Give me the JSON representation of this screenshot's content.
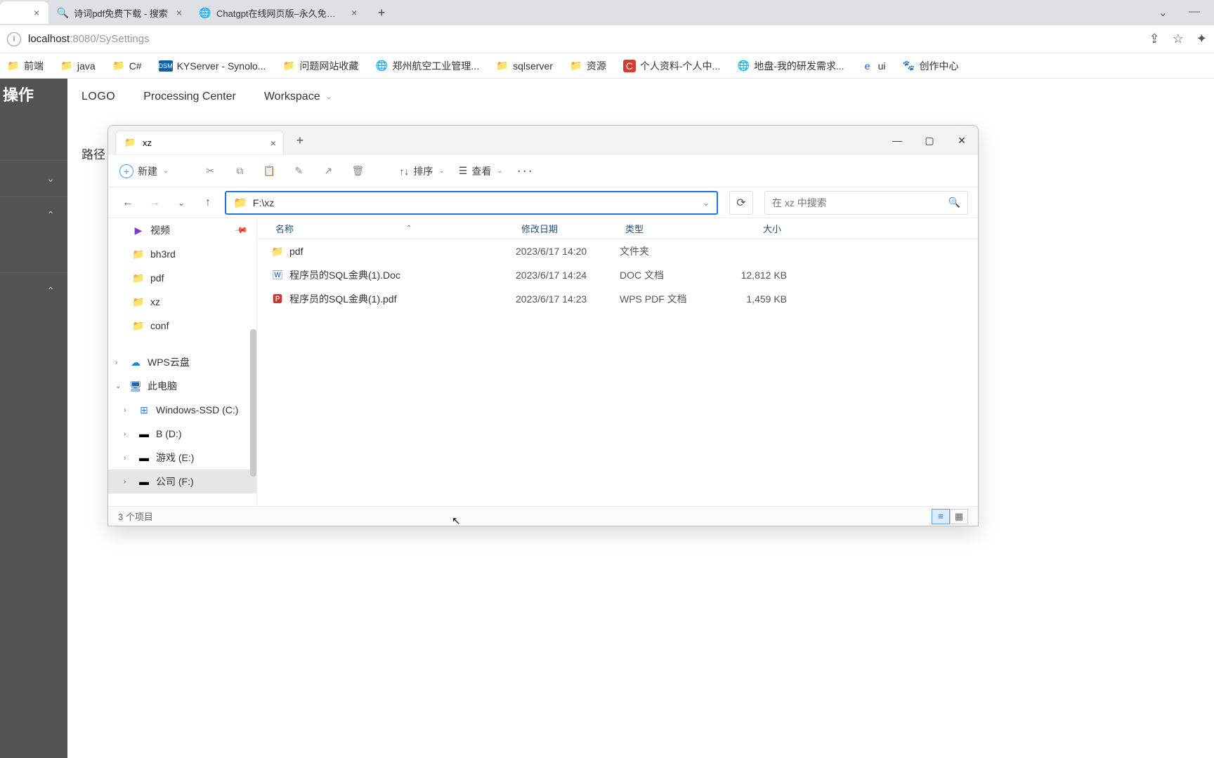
{
  "browser": {
    "tabs": [
      {
        "title": "",
        "active": true
      },
      {
        "title": "诗词pdf免费下载 - 搜索",
        "active": false
      },
      {
        "title": "Chatgpt在线网页版–永久免费使",
        "active": false
      }
    ],
    "url_host": "localhost",
    "url_port": ":8080",
    "url_path": "/SySettings",
    "window_hint_dd": "⌄",
    "window_hint_min": "—"
  },
  "bookmarks": [
    {
      "label": "前端",
      "icon": "folder"
    },
    {
      "label": "java",
      "icon": "folder"
    },
    {
      "label": "C#",
      "icon": "folder"
    },
    {
      "label": "KYServer - Synolo...",
      "icon": "dsm"
    },
    {
      "label": "问题网站收藏",
      "icon": "folder"
    },
    {
      "label": "郑州航空工业管理...",
      "icon": "globe"
    },
    {
      "label": "sqlserver",
      "icon": "folder"
    },
    {
      "label": "资源",
      "icon": "folder"
    },
    {
      "label": "个人资料-个人中...",
      "icon": "c-red"
    },
    {
      "label": "地盘-我的研发需求...",
      "icon": "globe-blue"
    },
    {
      "label": "ui",
      "icon": "ie"
    },
    {
      "label": "创作中心",
      "icon": "paw"
    }
  ],
  "left_panel": {
    "title": "操作",
    "chevrons": [
      "⌄",
      "⌃",
      "⌃",
      "⌃"
    ]
  },
  "top_nav": {
    "logo": "LOGO",
    "items": [
      "Processing Center",
      "Workspace"
    ]
  },
  "path_label": "路径",
  "explorer": {
    "tab_title": "xz",
    "toolbar": {
      "new_label": "新建",
      "sort_label": "排序",
      "view_label": "查看",
      "more": "···"
    },
    "path_value": "F:\\xz",
    "search_placeholder": "在 xz 中搜索",
    "sidebar": {
      "quick": [
        {
          "label": "视频",
          "icon": "video",
          "pinned": true
        },
        {
          "label": "bh3rd",
          "icon": "folder"
        },
        {
          "label": "pdf",
          "icon": "folder"
        },
        {
          "label": "xz",
          "icon": "folder"
        },
        {
          "label": "conf",
          "icon": "folder"
        }
      ],
      "drives_top": [
        {
          "label": "WPS云盘",
          "icon": "cloud",
          "arrow": "›"
        },
        {
          "label": "此电脑",
          "icon": "pc",
          "arrow": "⌄"
        }
      ],
      "drives": [
        {
          "label": "Windows-SSD (C:)",
          "icon": "ssd",
          "arrow": "›"
        },
        {
          "label": "B (D:)",
          "icon": "disk",
          "arrow": "›"
        },
        {
          "label": "游戏 (E:)",
          "icon": "disk",
          "arrow": "›"
        },
        {
          "label": "公司 (F:)",
          "icon": "disk",
          "arrow": "›"
        }
      ]
    },
    "columns": {
      "name": "名称",
      "date": "修改日期",
      "type": "类型",
      "size": "大小"
    },
    "files": [
      {
        "name": "pdf",
        "date": "2023/6/17 14:20",
        "type": "文件夹",
        "size": "",
        "icon": "folder"
      },
      {
        "name": "程序员的SQL金典(1).Doc",
        "date": "2023/6/17 14:24",
        "type": "DOC 文档",
        "size": "12,812 KB",
        "icon": "doc"
      },
      {
        "name": "程序员的SQL金典(1).pdf",
        "date": "2023/6/17 14:23",
        "type": "WPS PDF 文档",
        "size": "1,459 KB",
        "icon": "pdf"
      }
    ],
    "status": "3 个项目"
  }
}
